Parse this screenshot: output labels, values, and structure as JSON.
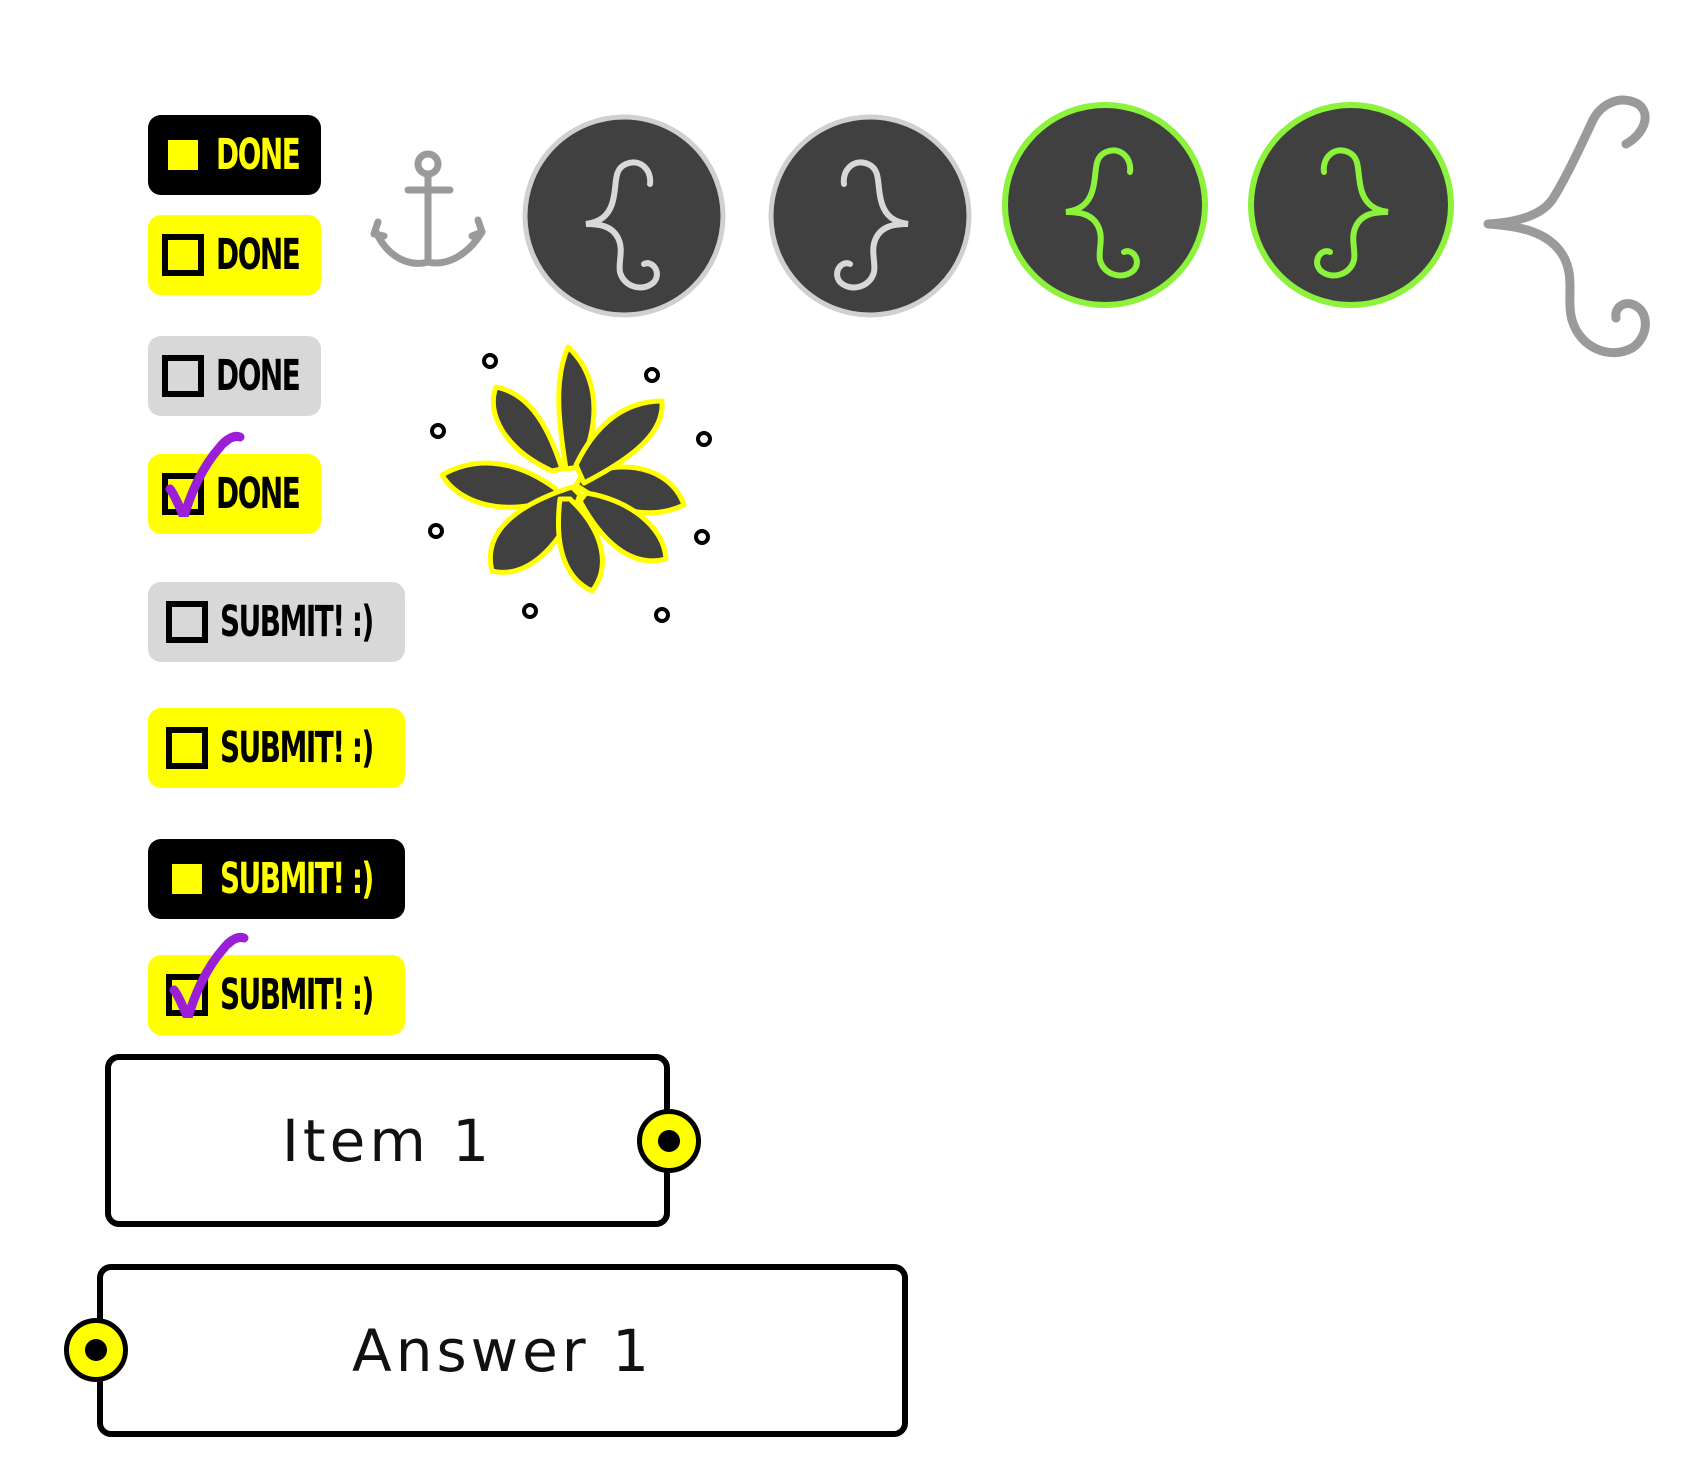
{
  "buttons": {
    "done_label": "DONE",
    "submit_label": "SUBMIT! :)"
  },
  "cards": {
    "item_label": "Item 1",
    "answer_label": "Answer 1"
  },
  "icons": {
    "anchor": "anchor-icon",
    "prev": "curly-brace-left-icon",
    "next": "curly-brace-right-icon",
    "flower": "flower-icon",
    "checkmark": "checkmark-icon"
  },
  "colors": {
    "accent_yellow": "#ffff00",
    "accent_green": "#8cf23c",
    "check_purple": "#9b1fd6",
    "circle_dark": "#404040",
    "disabled_grey": "#d8d8d8"
  }
}
